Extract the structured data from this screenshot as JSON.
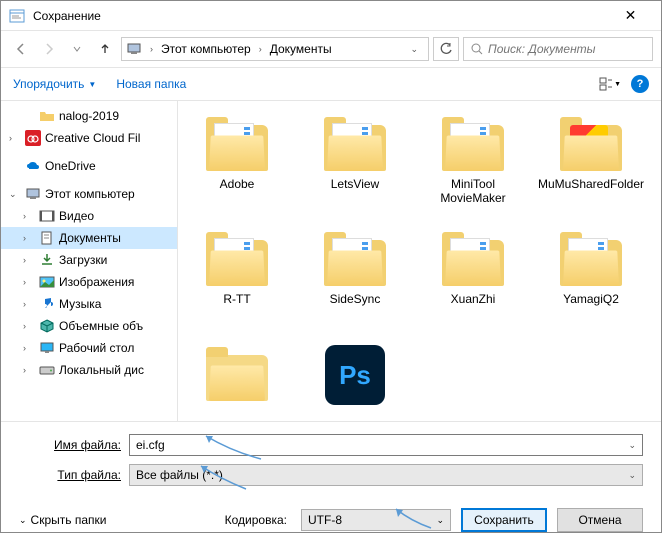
{
  "window": {
    "title": "Сохранение"
  },
  "breadcrumb": {
    "seg1": "Этот компьютер",
    "seg2": "Документы"
  },
  "search": {
    "placeholder": "Поиск: Документы"
  },
  "toolbar": {
    "organize": "Упорядочить",
    "newfolder": "Новая папка"
  },
  "tree": {
    "nalog": "nalog-2019",
    "cc": "Creative Cloud Fil",
    "onedrive": "OneDrive",
    "thispc": "Этот компьютер",
    "video": "Видео",
    "documents": "Документы",
    "downloads": "Загрузки",
    "pictures": "Изображения",
    "music": "Музыка",
    "objects3d": "Объемные объ",
    "desktop": "Рабочий стол",
    "localdisk": "Локальный дис"
  },
  "folders": {
    "adobe": "Adobe",
    "letsview": "LetsView",
    "minitool": "MiniTool MovieMaker",
    "mumu": "MuMuSharedFolder",
    "rtt": "R-TT",
    "sidesync": "SideSync",
    "xuanzhi": "XuanZhi",
    "yamagi": "YamagiQ2"
  },
  "form": {
    "filename_label": "Имя файла:",
    "filename_value": "ei.cfg",
    "filetype_label": "Тип файла:",
    "filetype_value": "Все файлы  (*.*)"
  },
  "footer": {
    "hide": "Скрыть папки",
    "encoding_label": "Кодировка:",
    "encoding_value": "UTF-8",
    "save": "Сохранить",
    "cancel": "Отмена"
  }
}
